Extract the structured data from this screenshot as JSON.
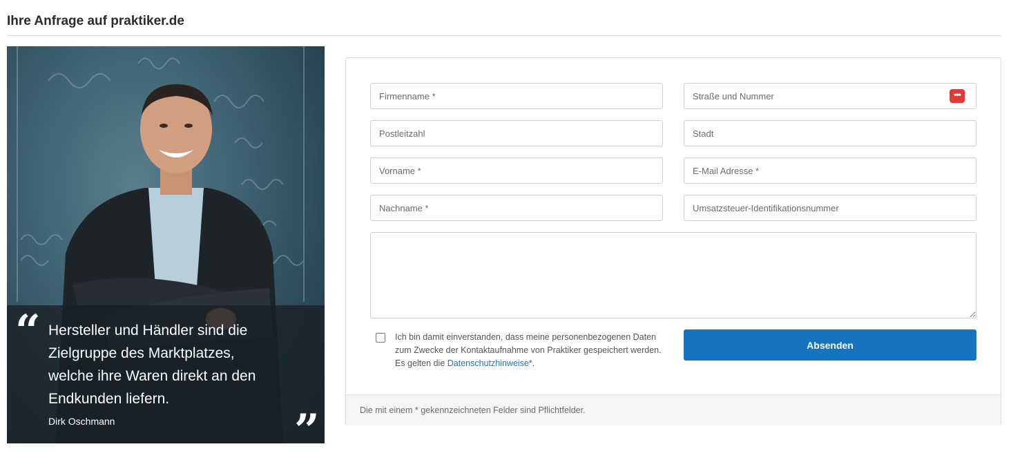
{
  "header": {
    "title": "Ihre Anfrage auf praktiker.de"
  },
  "testimonial": {
    "quote": "Hersteller und Händler sind die Zielgruppe des Marktplatzes, welche ihre Waren direkt an den Endkunden liefern.",
    "author": "Dirk Oschmann",
    "open_mark": "“",
    "close_mark": "”"
  },
  "form": {
    "fields": {
      "company": {
        "placeholder": "Firmenname *",
        "value": ""
      },
      "street": {
        "placeholder": "Straße und Nummer",
        "value": ""
      },
      "zip": {
        "placeholder": "Postleitzahl",
        "value": ""
      },
      "city": {
        "placeholder": "Stadt",
        "value": ""
      },
      "firstname": {
        "placeholder": "Vorname *",
        "value": ""
      },
      "email": {
        "placeholder": "E-Mail Adresse *",
        "value": ""
      },
      "lastname": {
        "placeholder": "Nachname *",
        "value": ""
      },
      "vat_id": {
        "placeholder": "Umsatzsteuer-Identifikationsnummer",
        "value": ""
      },
      "message": {
        "placeholder": "",
        "value": ""
      }
    },
    "password_manager_icon": "•••",
    "consent": {
      "checked": false,
      "text_before": "Ich bin damit einverstanden, dass meine personenbezogenen Daten zum Zwecke der Kontaktaufnahme von Praktiker gespeichert werden. Es gelten die ",
      "link_label": "Datenschutzhinweise",
      "text_after": "*."
    },
    "submit_label": "Absenden",
    "footer_note": "Die mit einem * gekennzeichneten Felder sind Pflichtfelder."
  },
  "colors": {
    "accent": "#1574bf",
    "link": "#1b75bb",
    "password_icon": "#e53935"
  },
  "icons": {
    "quote_open": "quote-open-icon",
    "quote_close": "quote-close-icon",
    "password_manager": "password-manager-icon"
  }
}
